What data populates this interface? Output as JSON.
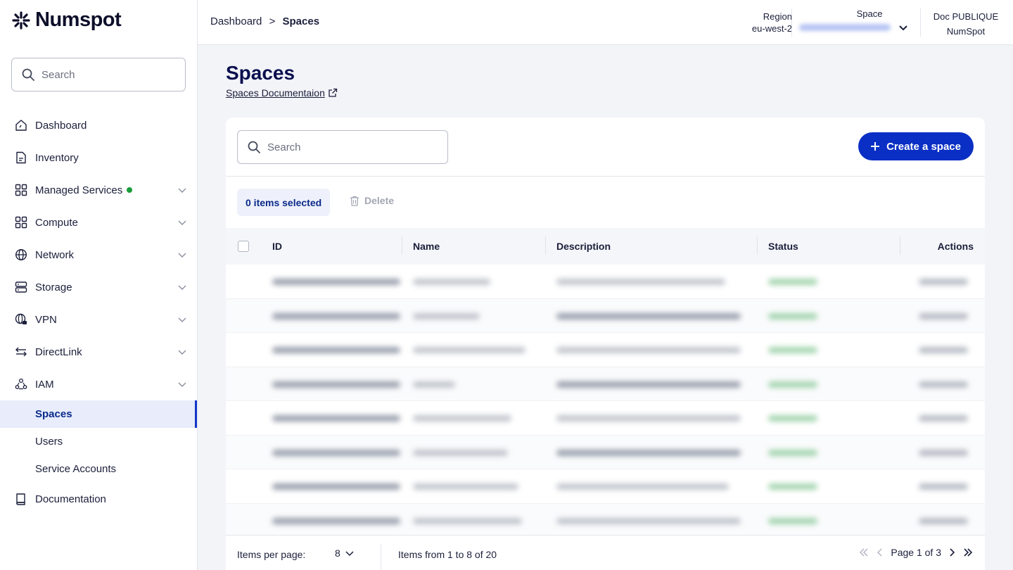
{
  "app": {
    "logo_text": "Numspot"
  },
  "sidebar": {
    "search_placeholder": "Search",
    "items": [
      {
        "label": "Dashboard",
        "icon": "home-icon"
      },
      {
        "label": "Inventory",
        "icon": "document-icon"
      },
      {
        "label": "Managed Services",
        "icon": "grid-icon",
        "status_dot": true
      },
      {
        "label": "Compute",
        "icon": "grid-icon"
      },
      {
        "label": "Network",
        "icon": "globe-icon"
      },
      {
        "label": "Storage",
        "icon": "server-icon"
      },
      {
        "label": "VPN",
        "icon": "globe-lock-icon"
      },
      {
        "label": "DirectLink",
        "icon": "arrows-icon"
      },
      {
        "label": "IAM",
        "icon": "people-icon"
      }
    ],
    "iam_sub": [
      {
        "label": "Spaces",
        "active": true
      },
      {
        "label": "Users"
      },
      {
        "label": "Service Accounts"
      }
    ],
    "documentation": "Documentation"
  },
  "topbar": {
    "breadcrumb_root": "Dashboard",
    "breadcrumb_sep": ">",
    "breadcrumb_current": "Spaces",
    "region_label": "Region",
    "region_value": "eu-west-2",
    "space_label": "Space",
    "org_name": "Doc PUBLIQUE",
    "org_company": "NumSpot"
  },
  "page": {
    "title": "Spaces",
    "doc_link": "Spaces Documentaion"
  },
  "toolbar": {
    "search_placeholder": "Search",
    "create_label": "Create a space",
    "selected_label": "0 items selected",
    "delete_label": "Delete"
  },
  "table": {
    "columns": [
      "ID",
      "Name",
      "Description",
      "Status",
      "Actions"
    ],
    "row_count": 8
  },
  "footer": {
    "per_page_label": "Items per page:",
    "per_page_value": "8",
    "range_text": "Items from 1 to 8 of 20",
    "page_text": "Page 1 of 3"
  },
  "colors": {
    "primary": "#0a2fc4",
    "title": "#0a0f4e",
    "status_green": "#1a9d3c",
    "active_bg": "#e8ecfb"
  }
}
